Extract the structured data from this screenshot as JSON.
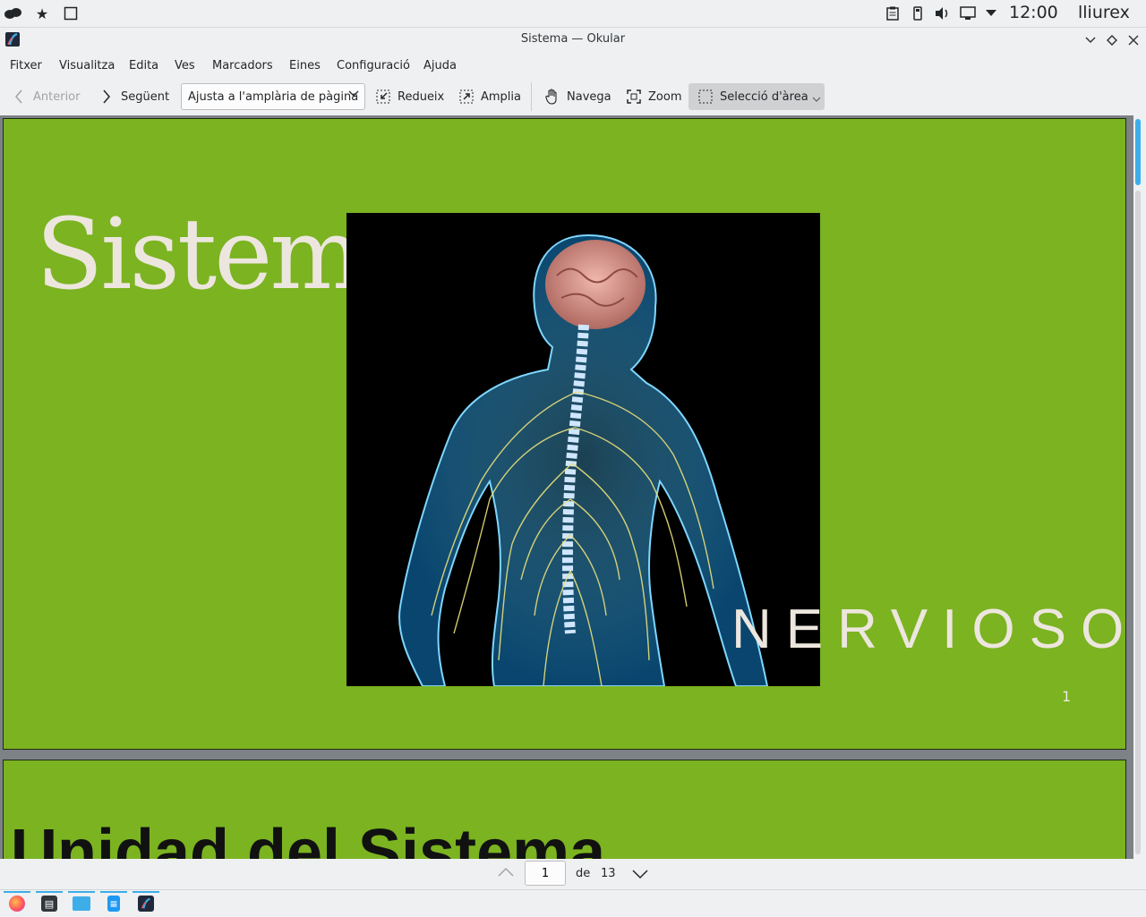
{
  "top_panel": {
    "clock": "12:00",
    "user": "lliurex",
    "left_icons": [
      "cloud-icon",
      "star-icon",
      "window-icon"
    ],
    "tray_icons": [
      "clipboard-icon",
      "usb-icon",
      "volume-icon",
      "network-icon",
      "tray-expand-icon"
    ]
  },
  "window": {
    "title": "Sistema — Okular"
  },
  "menu": [
    "Fitxer",
    "Visualitza",
    "Edita",
    "Ves",
    "Marcadors",
    "Eines",
    "Configuració",
    "Ajuda"
  ],
  "toolbar": {
    "previous": "Anterior",
    "next": "Següent",
    "zoom_mode": "Ajusta a l'amplària de pàgina",
    "zoom_out": "Redueix",
    "zoom_in": "Amplia",
    "browse": "Navega",
    "zoom": "Zoom",
    "area_select": "Selecció d'àrea"
  },
  "document": {
    "page1": {
      "title": "Sistema",
      "subtitle": "NERVIOSO",
      "number": "1"
    },
    "page2": {
      "title": "Unidad del Sistema"
    }
  },
  "page_nav": {
    "current": "1",
    "of": "de",
    "total": "13"
  },
  "taskbar": [
    "firefox-icon",
    "terminal-icon",
    "file-manager-icon",
    "document-icon",
    "okular-icon"
  ],
  "colors": {
    "slide_green": "#7bb321",
    "slide_text": "#ede6de",
    "accent": "#3daee9"
  }
}
